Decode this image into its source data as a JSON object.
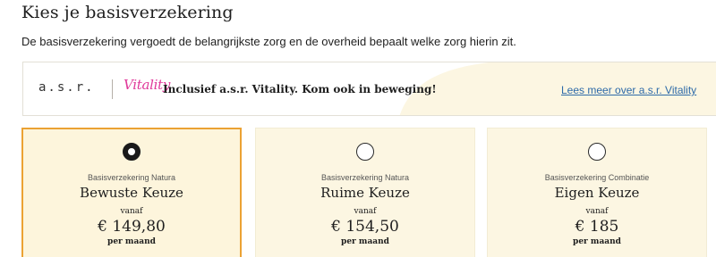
{
  "header": {
    "title": "Kies je basisverzekering",
    "intro": "De basisverzekering vergoedt de belangrijkste zorg en de overheid bepaalt welke zorg hierin zit."
  },
  "promo": {
    "asr_logo": "a.s.r.",
    "vitality_logo": "Vitality",
    "text": "Inclusief a.s.r. Vitality. Kom ook in beweging!",
    "link": "Lees meer over a.s.r. Vitality",
    "accent_color": "#fcf6e2",
    "vitality_color": "#e0399a"
  },
  "cards": [
    {
      "label": "Basisverzekering Natura",
      "title": "Bewuste Keuze",
      "from": "vanaf",
      "price": "€ 149,80",
      "period": "per maand",
      "selected": true
    },
    {
      "label": "Basisverzekering Natura",
      "title": "Ruime Keuze",
      "from": "vanaf",
      "price": "€ 154,50",
      "period": "per maand",
      "selected": false
    },
    {
      "label": "Basisverzekering Combinatie",
      "title": "Eigen Keuze",
      "from": "vanaf",
      "price": "€ 185",
      "period": "per maand",
      "selected": false
    }
  ],
  "colors": {
    "selected_border": "#eba233",
    "card_background": "#fcf6e2",
    "link": "#2d6aa8"
  }
}
